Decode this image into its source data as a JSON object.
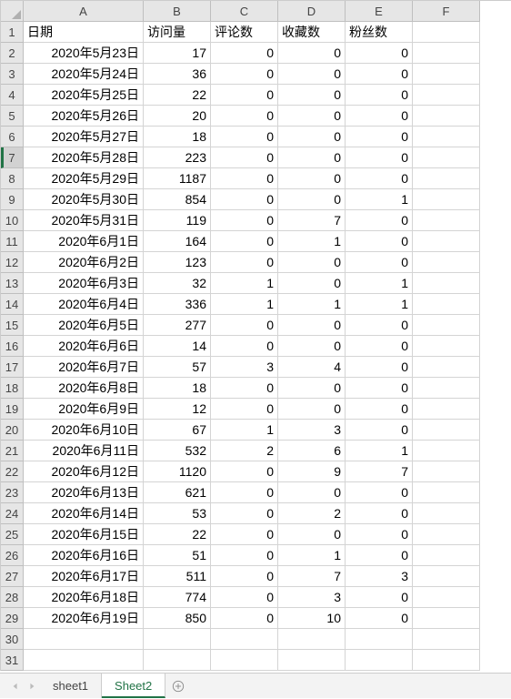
{
  "columns": [
    "A",
    "B",
    "C",
    "D",
    "E",
    "F"
  ],
  "headers": {
    "A": "日期",
    "B": "访问量",
    "C": "评论数",
    "D": "收藏数",
    "E": "粉丝数",
    "F": ""
  },
  "selectedRow": 7,
  "rowCount": 31,
  "rows": [
    {
      "A": "2020年5月23日",
      "B": 17,
      "C": 0,
      "D": 0,
      "E": 0
    },
    {
      "A": "2020年5月24日",
      "B": 36,
      "C": 0,
      "D": 0,
      "E": 0
    },
    {
      "A": "2020年5月25日",
      "B": 22,
      "C": 0,
      "D": 0,
      "E": 0
    },
    {
      "A": "2020年5月26日",
      "B": 20,
      "C": 0,
      "D": 0,
      "E": 0
    },
    {
      "A": "2020年5月27日",
      "B": 18,
      "C": 0,
      "D": 0,
      "E": 0
    },
    {
      "A": "2020年5月28日",
      "B": 223,
      "C": 0,
      "D": 0,
      "E": 0
    },
    {
      "A": "2020年5月29日",
      "B": 1187,
      "C": 0,
      "D": 0,
      "E": 0
    },
    {
      "A": "2020年5月30日",
      "B": 854,
      "C": 0,
      "D": 0,
      "E": 1
    },
    {
      "A": "2020年5月31日",
      "B": 119,
      "C": 0,
      "D": 7,
      "E": 0
    },
    {
      "A": "2020年6月1日",
      "B": 164,
      "C": 0,
      "D": 1,
      "E": 0
    },
    {
      "A": "2020年6月2日",
      "B": 123,
      "C": 0,
      "D": 0,
      "E": 0
    },
    {
      "A": "2020年6月3日",
      "B": 32,
      "C": 1,
      "D": 0,
      "E": 1
    },
    {
      "A": "2020年6月4日",
      "B": 336,
      "C": 1,
      "D": 1,
      "E": 1
    },
    {
      "A": "2020年6月5日",
      "B": 277,
      "C": 0,
      "D": 0,
      "E": 0
    },
    {
      "A": "2020年6月6日",
      "B": 14,
      "C": 0,
      "D": 0,
      "E": 0
    },
    {
      "A": "2020年6月7日",
      "B": 57,
      "C": 3,
      "D": 4,
      "E": 0
    },
    {
      "A": "2020年6月8日",
      "B": 18,
      "C": 0,
      "D": 0,
      "E": 0
    },
    {
      "A": "2020年6月9日",
      "B": 12,
      "C": 0,
      "D": 0,
      "E": 0
    },
    {
      "A": "2020年6月10日",
      "B": 67,
      "C": 1,
      "D": 3,
      "E": 0
    },
    {
      "A": "2020年6月11日",
      "B": 532,
      "C": 2,
      "D": 6,
      "E": 1
    },
    {
      "A": "2020年6月12日",
      "B": 1120,
      "C": 0,
      "D": 9,
      "E": 7
    },
    {
      "A": "2020年6月13日",
      "B": 621,
      "C": 0,
      "D": 0,
      "E": 0
    },
    {
      "A": "2020年6月14日",
      "B": 53,
      "C": 0,
      "D": 2,
      "E": 0
    },
    {
      "A": "2020年6月15日",
      "B": 22,
      "C": 0,
      "D": 0,
      "E": 0
    },
    {
      "A": "2020年6月16日",
      "B": 51,
      "C": 0,
      "D": 1,
      "E": 0
    },
    {
      "A": "2020年6月17日",
      "B": 511,
      "C": 0,
      "D": 7,
      "E": 3
    },
    {
      "A": "2020年6月18日",
      "B": 774,
      "C": 0,
      "D": 3,
      "E": 0
    },
    {
      "A": "2020年6月19日",
      "B": 850,
      "C": 0,
      "D": 10,
      "E": 0
    }
  ],
  "tabs": {
    "items": [
      {
        "label": "sheet1",
        "active": false
      },
      {
        "label": "Sheet2",
        "active": true
      }
    ]
  }
}
